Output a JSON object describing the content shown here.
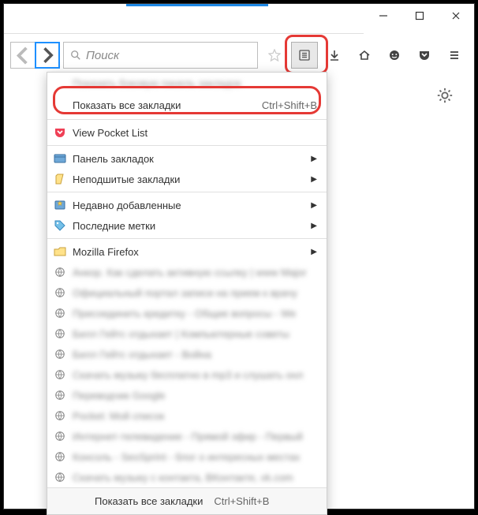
{
  "window": {
    "minimize": "—",
    "maximize": "□",
    "close": "✕"
  },
  "toolbar": {
    "search_placeholder": "Поиск"
  },
  "menu": {
    "row_truncated": "Показать боковую панель закладок",
    "show_all": "Показать все закладки",
    "show_all_shortcut": "Ctrl+Shift+B",
    "pocket": "View Pocket List",
    "bookmarks_bar": "Панель закладок",
    "unsorted": "Неподшитые закладки",
    "recent": "Недавно добавленные",
    "recent_tags": "Последние метки",
    "folder_firefox": "Mozilla Firefox",
    "bm0": "Анкор. Как сделать активную ссылку | www Major",
    "bm1": "Официальный портал записи на прием к врачу",
    "bm2": "Присоединить кредитку - Общие вопросы - We",
    "bm3": "Билл Гейтс отдыхает | Компьютерные советы",
    "bm4": "Билл Гейтс отдыхает - Война",
    "bm5": "Скачать музыку бесплатно в mp3 и слушать онл",
    "bm6": "Переводчик Google",
    "bm7": "Pocket: Мой список",
    "bm8": "Интернет-телевидение - Прямой эфир - Первый",
    "bm9": "Консоль - SeoSprint - блог о интересных местах",
    "bm10": "Скачать музыку с контакта, ВКонтакте, vk.com",
    "footer_label": "Показать все закладки",
    "footer_shortcut": "Ctrl+Shift+B"
  }
}
